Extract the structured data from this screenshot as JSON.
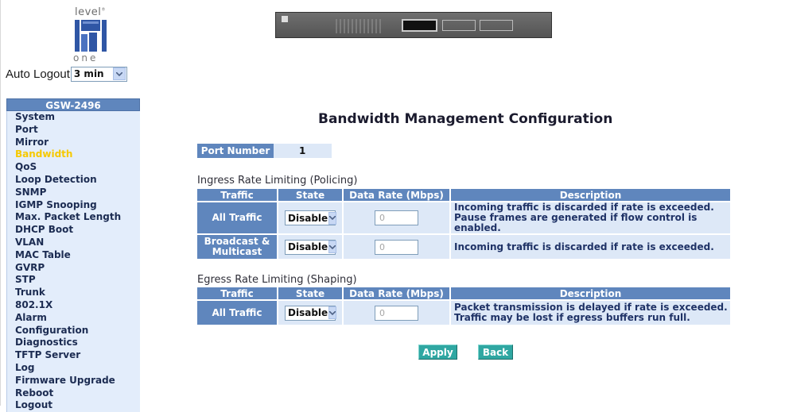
{
  "logo": {
    "top_text": "level",
    "mark": "®",
    "bottom_text": "one"
  },
  "auto_logout": {
    "label": "Auto Logout",
    "selected": "3 min"
  },
  "sidebar": {
    "header": "GSW-2496",
    "items": [
      {
        "label": "System"
      },
      {
        "label": "Port"
      },
      {
        "label": "Mirror"
      },
      {
        "label": "Bandwidth",
        "active": true
      },
      {
        "label": "QoS"
      },
      {
        "label": "Loop Detection"
      },
      {
        "label": "SNMP"
      },
      {
        "label": "IGMP Snooping"
      },
      {
        "label": "Max. Packet Length"
      },
      {
        "label": "DHCP Boot"
      },
      {
        "label": "VLAN"
      },
      {
        "label": "MAC Table"
      },
      {
        "label": "GVRP"
      },
      {
        "label": "STP"
      },
      {
        "label": "Trunk"
      },
      {
        "label": "802.1X"
      },
      {
        "label": "Alarm"
      },
      {
        "label": "Configuration"
      },
      {
        "label": "Diagnostics"
      },
      {
        "label": "TFTP Server"
      },
      {
        "label": "Log"
      },
      {
        "label": "Firmware Upgrade"
      },
      {
        "label": "Reboot"
      },
      {
        "label": "Logout"
      }
    ],
    "active_color": "#f6c900"
  },
  "main": {
    "title": "Bandwidth Management Configuration",
    "port_label": "Port Number",
    "port_value": "1",
    "ingress": {
      "title": "Ingress Rate Limiting (Policing)",
      "headers": [
        "Traffic",
        "State",
        "Data Rate (Mbps)",
        "Description"
      ],
      "rows": [
        {
          "traffic": "All Traffic",
          "state": "Disable",
          "rate": "0",
          "desc1": "Incoming traffic is discarded if rate is exceeded.",
          "desc2": "Pause frames are generated if flow control is enabled."
        },
        {
          "traffic1": "Broadcast &",
          "traffic2": "Multicast",
          "state": "Disable",
          "rate": "0",
          "desc1": "Incoming traffic is discarded if rate is exceeded."
        }
      ]
    },
    "egress": {
      "title": "Egress Rate Limiting (Shaping)",
      "headers": [
        "Traffic",
        "State",
        "Data Rate (Mbps)",
        "Description"
      ],
      "rows": [
        {
          "traffic": "All Traffic",
          "state": "Disable",
          "rate": "0",
          "desc1": "Packet transmission is delayed if rate is exceeded.",
          "desc2": "Traffic may be lost if egress buffers run full."
        }
      ]
    },
    "apply_label": "Apply",
    "back_label": "Back"
  },
  "colors": {
    "header_blue": "#5f86bd",
    "cell_light": "#dde8f7",
    "button_teal": "#2fa7a2"
  }
}
